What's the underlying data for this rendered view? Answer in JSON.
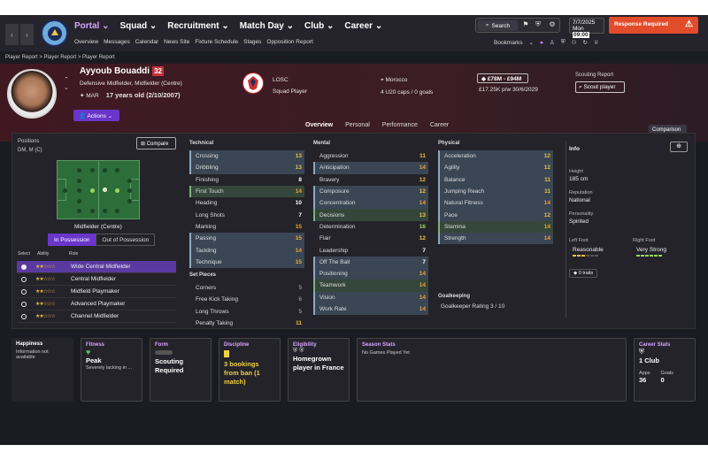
{
  "nav": {
    "menu": [
      "Portal",
      "Squad",
      "Recruitment",
      "Match Day",
      "Club",
      "Career"
    ],
    "submenu": [
      "Overview",
      "Messages",
      "Calendar",
      "News Site",
      "Fixture Schedule",
      "Stages",
      "Opposition Report"
    ],
    "search": "Search",
    "date_line1": "7/7/2025",
    "date_line2": "Mon",
    "time": "09:00",
    "response": "Response Required",
    "bookmarks": "Bookmarks"
  },
  "breadcrumb": "Player Report  >  Player Report  >  Player Report",
  "player": {
    "name": "Ayyoub Bouaddi",
    "number": "32",
    "positions": "Defensive Midfielder, Midfielder (Centre)",
    "nat_code": "MAR",
    "age": "17 years old (2/10/2007)",
    "actions": "Actions",
    "club": "LOSC",
    "club_status": "Squad Player",
    "nationality": "Morocco",
    "caps": "4 U20 caps / 0 goals",
    "value": "£78M - £94M",
    "wage": "£17.25K p/w  30/6/2029",
    "scout_label": "Scouting Report",
    "scout_btn": "Scout player"
  },
  "tabs": [
    "Overview",
    "Personal",
    "Performance",
    "Career"
  ],
  "comparison": "Comparison",
  "positions_panel": {
    "label": "Positions",
    "value": "DM, M (C)",
    "compare": "Compare",
    "pitch_label": "Midfielder (Centre)",
    "in_possession": "In Possession",
    "out_possession": "Out of Possession",
    "hdr_select": "Select",
    "hdr_ability": "Ability",
    "hdr_role": "Role",
    "roles": [
      {
        "name": "Wide Central Midfielder",
        "stars": "★★☆☆☆"
      },
      {
        "name": "Central Midfielder",
        "stars": "★★☆☆☆"
      },
      {
        "name": "Midfield Playmaker",
        "stars": "★★☆☆☆"
      },
      {
        "name": "Advanced Playmaker",
        "stars": "★★☆☆☆"
      },
      {
        "name": "Channel Midfielder",
        "stars": "★★☆☆☆"
      }
    ]
  },
  "technical": {
    "label": "Technical",
    "items": [
      {
        "n": "Crossing",
        "v": "13"
      },
      {
        "n": "Dribbling",
        "v": "13"
      },
      {
        "n": "Finishing",
        "v": "8"
      },
      {
        "n": "First Touch",
        "v": "14"
      },
      {
        "n": "Heading",
        "v": "10"
      },
      {
        "n": "Long Shots",
        "v": "7"
      },
      {
        "n": "Marking",
        "v": "15"
      },
      {
        "n": "Passing",
        "v": "15"
      },
      {
        "n": "Tackling",
        "v": "14"
      },
      {
        "n": "Technique",
        "v": "15"
      }
    ]
  },
  "set_pieces": {
    "label": "Set Pieces",
    "items": [
      {
        "n": "Corners",
        "v": "5"
      },
      {
        "n": "Free Kick Taking",
        "v": "6"
      },
      {
        "n": "Long Throws",
        "v": "5"
      },
      {
        "n": "Penalty Taking",
        "v": "11"
      }
    ]
  },
  "mental": {
    "label": "Mental",
    "items": [
      {
        "n": "Aggression",
        "v": "11"
      },
      {
        "n": "Anticipation",
        "v": "14"
      },
      {
        "n": "Bravery",
        "v": "12"
      },
      {
        "n": "Composure",
        "v": "12"
      },
      {
        "n": "Concentration",
        "v": "14"
      },
      {
        "n": "Decisions",
        "v": "13"
      },
      {
        "n": "Determination",
        "v": "16"
      },
      {
        "n": "Flair",
        "v": "12"
      },
      {
        "n": "Leadership",
        "v": "7"
      },
      {
        "n": "Off The Ball",
        "v": "7"
      },
      {
        "n": "Positioning",
        "v": "14"
      },
      {
        "n": "Teamwork",
        "v": "14"
      },
      {
        "n": "Vision",
        "v": "14"
      },
      {
        "n": "Work Rate",
        "v": "14"
      }
    ]
  },
  "physical": {
    "label": "Physical",
    "items": [
      {
        "n": "Acceleration",
        "v": "12"
      },
      {
        "n": "Agility",
        "v": "12"
      },
      {
        "n": "Balance",
        "v": "11"
      },
      {
        "n": "Jumping Reach",
        "v": "11"
      },
      {
        "n": "Natural Fitness",
        "v": "14"
      },
      {
        "n": "Pace",
        "v": "12"
      },
      {
        "n": "Stamina",
        "v": "14"
      },
      {
        "n": "Strength",
        "v": "14"
      }
    ]
  },
  "goalkeeping": {
    "label": "Goalkeeping",
    "rating": "Goalkeeper Rating  3 / 10"
  },
  "info": {
    "label": "Info",
    "height_l": "Height",
    "height": "185 cm",
    "rep_l": "Reputation",
    "rep": "National",
    "pers_l": "Personality",
    "pers": "Spirited",
    "lf_l": "Left Foot",
    "lf": "Reasonable",
    "rf_l": "Right Foot",
    "rf": "Very Strong",
    "traits": "0 traits"
  },
  "cards": {
    "happiness_t": "Happiness",
    "happiness": "Information not available",
    "fitness_t": "Fitness",
    "fitness": "Peak",
    "fitness_s": "Severely lacking in ...",
    "form_t": "Form",
    "form": "Scouting Required",
    "disc_t": "Discipline",
    "disc": "3 bookings from ban (1 match)",
    "elig_t": "Eligibility",
    "elig": "Homegrown player in France",
    "season_t": "Season Stats",
    "season": "No Games Played Yet",
    "career_t": "Career Stats",
    "career": "1 Club",
    "apps_l": "Apps",
    "apps": "36",
    "goals_l": "Goals",
    "goals": "0"
  }
}
